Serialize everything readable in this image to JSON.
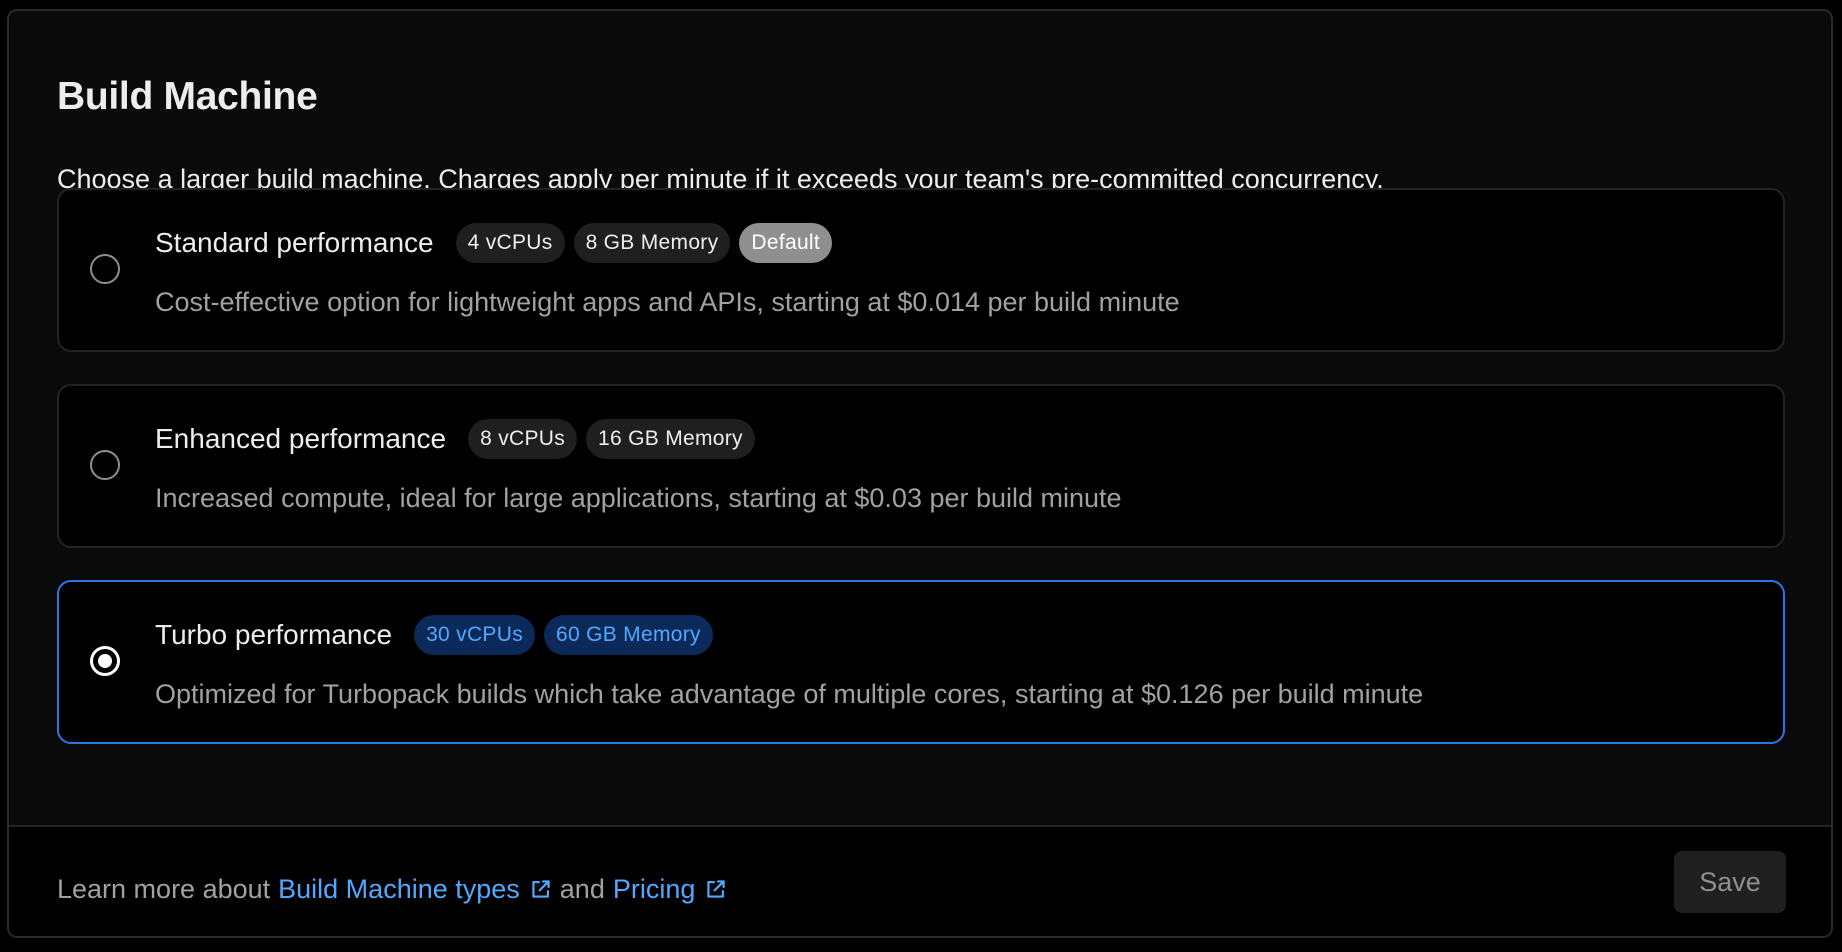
{
  "section": {
    "title": "Build Machine",
    "description": "Choose a larger build machine. Charges apply per minute if it exceeds your team's pre-committed concurrency."
  },
  "options": [
    {
      "name": "Standard performance",
      "cpu_badge": "4 vCPUs",
      "memory_badge": "8 GB Memory",
      "default_badge": "Default",
      "description": "Cost-effective option for lightweight apps and APIs, starting at $0.014 per build minute",
      "selected": false
    },
    {
      "name": "Enhanced performance",
      "cpu_badge": "8 vCPUs",
      "memory_badge": "16 GB Memory",
      "description": "Increased compute, ideal for large applications, starting at $0.03 per build minute",
      "selected": false
    },
    {
      "name": "Turbo performance",
      "cpu_badge": "30 vCPUs",
      "memory_badge": "60 GB Memory",
      "description": "Optimized for Turbopack builds which take advantage of multiple cores, starting at $0.126 per build minute",
      "selected": true
    }
  ],
  "footer": {
    "prefix": "Learn more about",
    "link_build_machine_types": "Build Machine types",
    "conjunction": "and",
    "link_pricing": "Pricing",
    "save_label": "Save",
    "save_enabled": false
  },
  "colors": {
    "accent_blue": "#52a8ff",
    "selected_border": "#2f74e6",
    "blue_badge_bg": "#0b2a59",
    "default_badge_bg": "#8f8f8f",
    "muted_text": "#a1a1a1"
  },
  "icons": {
    "external_link": "external-link-icon",
    "radio_selected": "radio-selected-icon",
    "radio_unselected": "radio-unselected-icon"
  }
}
